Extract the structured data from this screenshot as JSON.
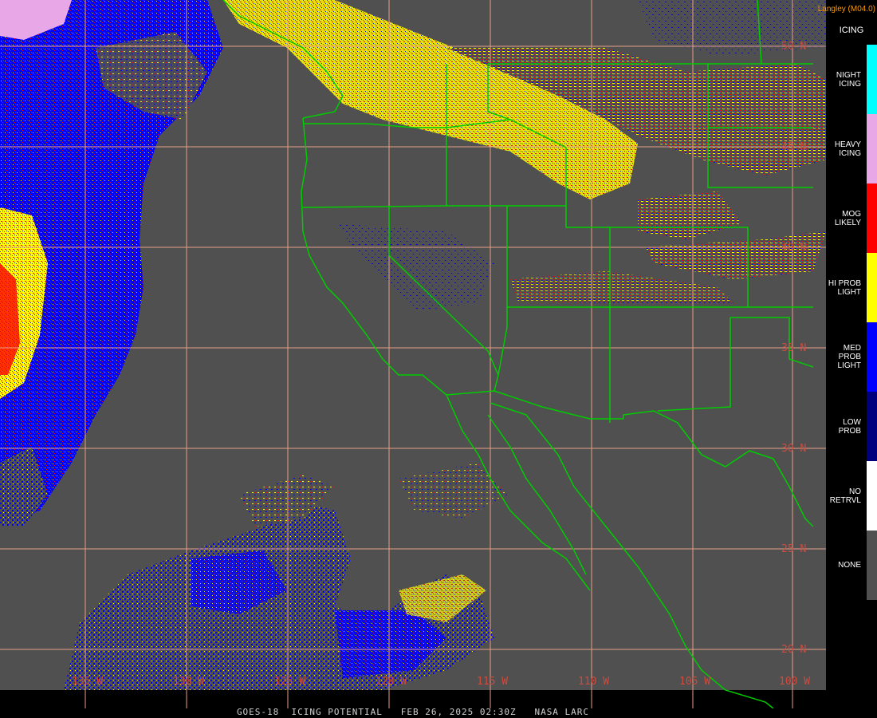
{
  "credit": "Langley (M04.0)",
  "caption": "GOES-18  ICING POTENTIAL   FEB 26, 2025 02:30Z   NASA LARC",
  "legend": {
    "title": "ICING",
    "items": [
      {
        "label": "NIGHT\nICING",
        "color": "#00ffff"
      },
      {
        "label": "HEAVY\nICING",
        "color": "#e8a8e8"
      },
      {
        "label": "MOG\nLIKELY",
        "color": "#ff0000"
      },
      {
        "label": "HI PROB\nLIGHT",
        "color": "#ffff00"
      },
      {
        "label": "MED PROB\nLIGHT",
        "color": "#0000ff"
      },
      {
        "label": "LOW\nPROB",
        "color": "#00007f"
      },
      {
        "label": "NO\nRETRVL",
        "color": "#ffffff"
      },
      {
        "label": "NONE",
        "color": "#505050"
      }
    ]
  },
  "map": {
    "background_color": "#505050",
    "grid_color": "#e8a088",
    "border_color": "#00cc00",
    "lat_labels": [
      "50 N",
      "45 N",
      "40 N",
      "35 N",
      "30 N",
      "25 N",
      "20 N"
    ],
    "lon_labels": [
      "135 W",
      "130 W",
      "125 W",
      "120 W",
      "115 W",
      "110 W",
      "105 W",
      "100 W"
    ]
  }
}
